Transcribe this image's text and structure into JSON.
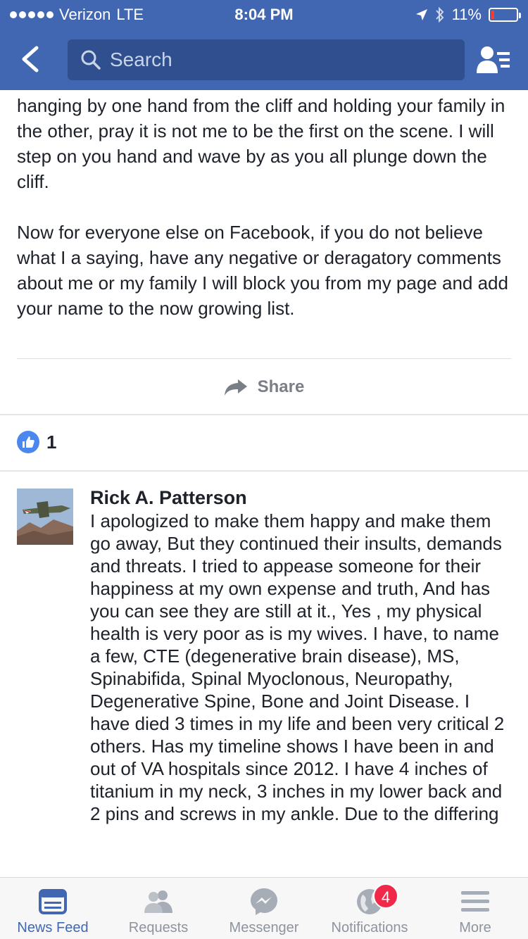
{
  "status_bar": {
    "carrier": "Verizon",
    "network": "LTE",
    "time": "8:04 PM",
    "battery": "11%",
    "battery_level": 0.11
  },
  "nav": {
    "search_placeholder": "Search"
  },
  "post": {
    "paragraphs": [
      "hanging by one hand from the cliff and holding your family in the other, pray it is not me to be the first on the scene.  I will step on you hand and wave by as you all plunge down the cliff.",
      "Now for everyone else on Facebook, if you do not believe what I a saying, have any negative or deragatory comments about me or my family I will block you from my page and add your name to the now growing list."
    ],
    "share_label": "Share",
    "like_count": "1"
  },
  "comment": {
    "author": "Rick A. Patterson",
    "text": "I apologized to make them happy and make them go away,  But they continued their insults, demands and threats.  I tried to appease someone for their happiness at my own expense and truth,  And has you can see they are still at it.,  Yes , my physical health is very poor as is my wives.  I have, to name a few, CTE (degenerative brain disease), MS, Spinabifida, Spinal Myoclonous, Neuropathy, Degenerative Spine, Bone and Joint Disease. I have died 3 times in my life and been very critical 2 others.  Has my timeline shows I have been in and out of VA hospitals since 2012.  I have 4 inches of titanium in my neck, 3 inches in my lower back and 2 pins and screws in my ankle.   Due to the differing"
  },
  "tabbar": {
    "tabs": [
      {
        "label": "News Feed",
        "icon": "news-feed-icon"
      },
      {
        "label": "Requests",
        "icon": "friend-requests-icon"
      },
      {
        "label": "Messenger",
        "icon": "messenger-icon"
      },
      {
        "label": "Notifications",
        "icon": "globe-icon",
        "badge": "4"
      },
      {
        "label": "More",
        "icon": "menu-icon"
      }
    ]
  },
  "colors": {
    "brand": "#4267b2",
    "badge": "#f02849",
    "like": "#4a87ee"
  }
}
